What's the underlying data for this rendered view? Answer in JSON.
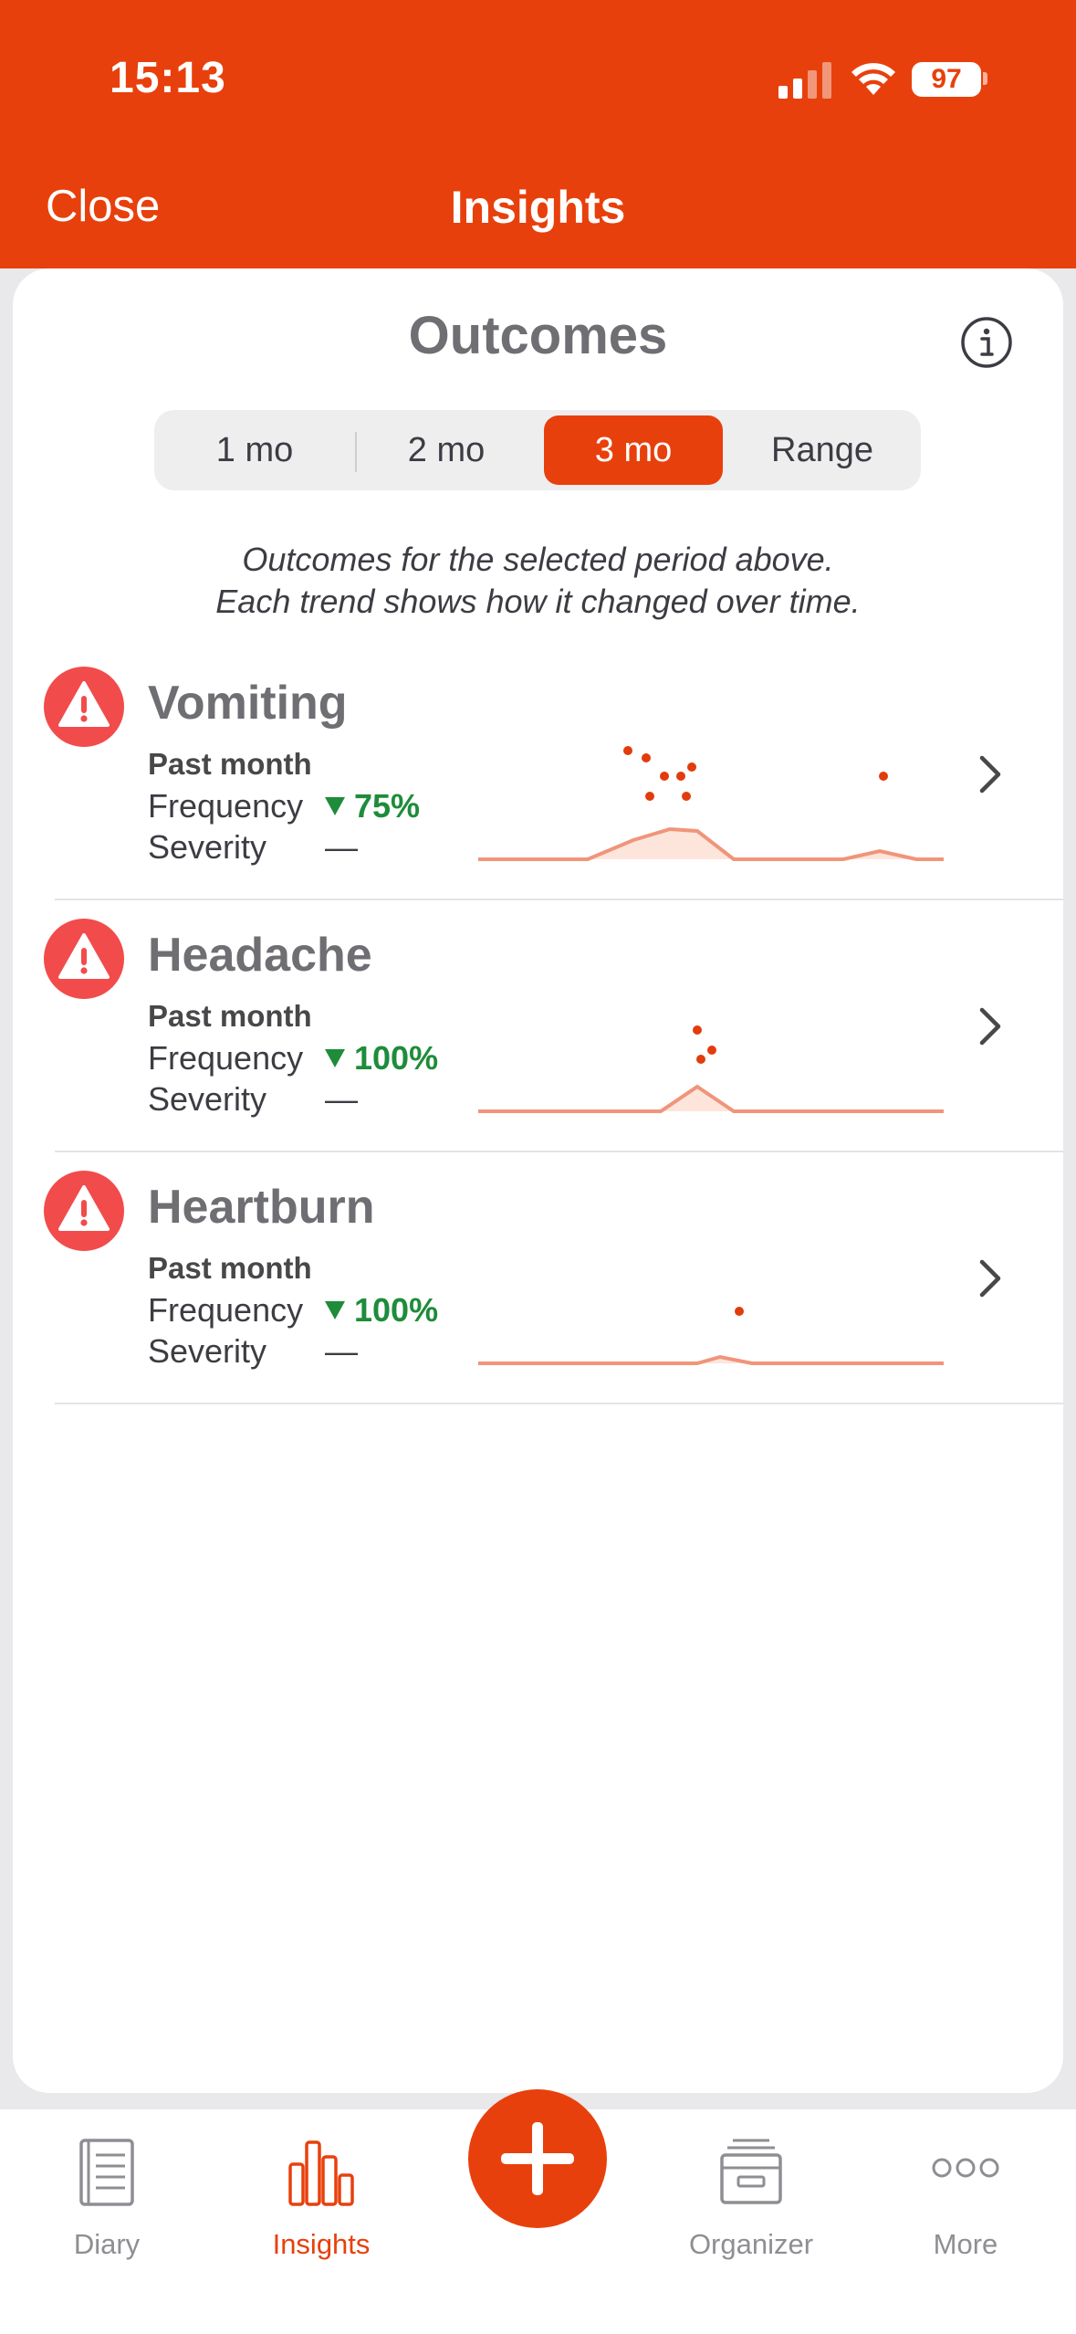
{
  "status_bar": {
    "time": "15:13",
    "battery": "97"
  },
  "nav": {
    "close_label": "Close",
    "title": "Insights"
  },
  "card": {
    "title": "Outcomes",
    "info_icon": "info-circle-icon",
    "periods": [
      {
        "label": "1 mo",
        "selected": false
      },
      {
        "label": "2 mo",
        "selected": false
      },
      {
        "label": "3 mo",
        "selected": true
      },
      {
        "label": "Range",
        "selected": false
      }
    ],
    "subtitle_line1": "Outcomes for the selected period above.",
    "subtitle_line2": "Each trend shows how it changed over time."
  },
  "outcomes": [
    {
      "name": "Vomiting",
      "period": "Past month",
      "frequency_label": "Frequency",
      "frequency_change": "75%",
      "severity_label": "Severity",
      "severity_value": "—",
      "icon": "warning-triangle-icon"
    },
    {
      "name": "Headache",
      "period": "Past month",
      "frequency_label": "Frequency",
      "frequency_change": "100%",
      "severity_label": "Severity",
      "severity_value": "—",
      "icon": "warning-triangle-icon"
    },
    {
      "name": "Heartburn",
      "period": "Past month",
      "frequency_label": "Frequency",
      "frequency_change": "100%",
      "severity_label": "Severity",
      "severity_value": "—",
      "icon": "warning-triangle-icon"
    }
  ],
  "tabbar": {
    "items": [
      {
        "label": "Diary",
        "icon": "diary-icon",
        "active": false
      },
      {
        "label": "Insights",
        "icon": "bar-chart-icon",
        "active": true
      },
      {
        "label": "Organizer",
        "icon": "archive-box-icon",
        "active": false
      },
      {
        "label": "More",
        "icon": "more-dots-icon",
        "active": false
      }
    ],
    "add_icon": "plus-icon"
  },
  "colors": {
    "accent": "#e8400c",
    "alert": "#f24b4b",
    "positive": "#1e8c3a",
    "spark_line": "#f0957a",
    "spark_dot": "#e23c0c"
  }
}
